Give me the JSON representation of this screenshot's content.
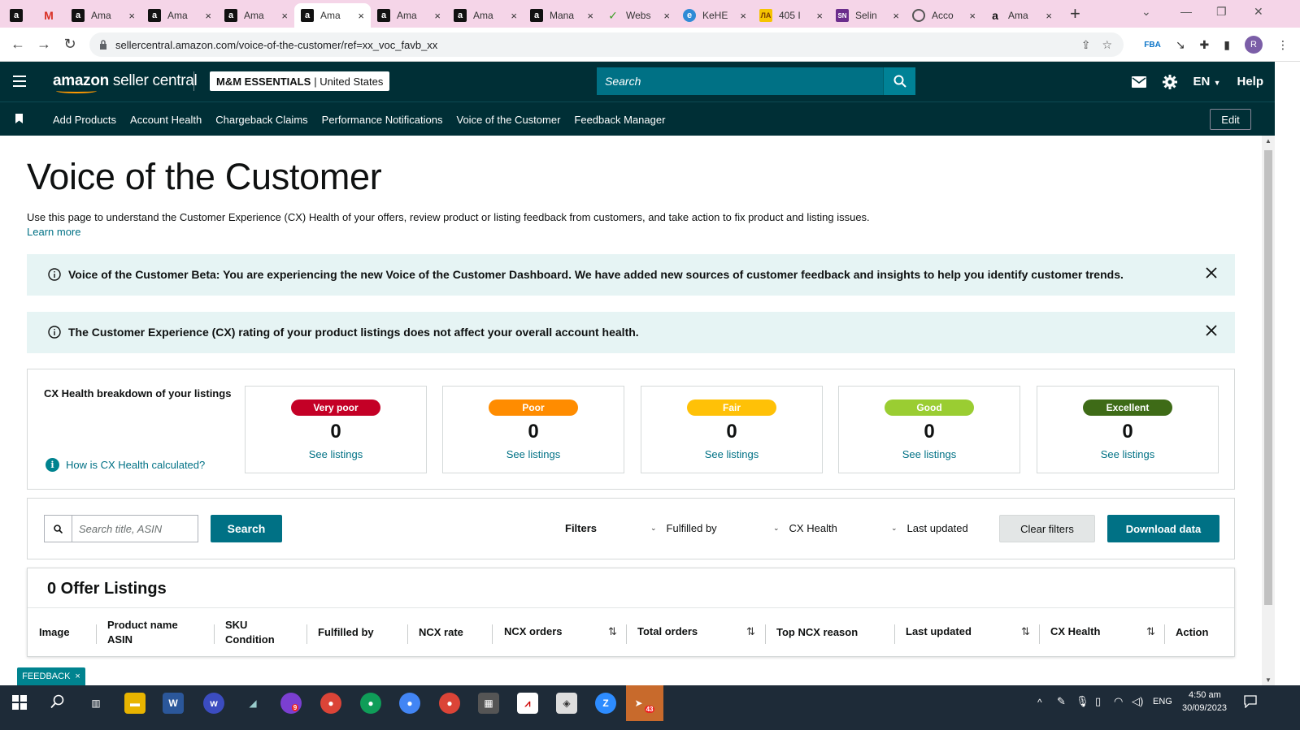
{
  "browser": {
    "tabs": [
      {
        "label": "",
        "icon": "amazon-a"
      },
      {
        "label": "",
        "icon": "gmail-m"
      },
      {
        "label": "Ama",
        "icon": "amazon-a"
      },
      {
        "label": "Ama",
        "icon": "amazon-a"
      },
      {
        "label": "Ama",
        "icon": "amazon-a"
      },
      {
        "label": "Ama",
        "icon": "amazon-a",
        "active": true
      },
      {
        "label": "Ama",
        "icon": "amazon-a"
      },
      {
        "label": "Ama",
        "icon": "amazon-a"
      },
      {
        "label": "Mana",
        "icon": "amazon-a"
      },
      {
        "label": "Webs",
        "icon": "web-leaf"
      },
      {
        "label": "KeHE",
        "icon": "kehe"
      },
      {
        "label": "405 I",
        "icon": "405"
      },
      {
        "label": "Selin",
        "icon": "sn"
      },
      {
        "label": "Acco",
        "icon": "globe"
      },
      {
        "label": "Ama",
        "icon": "amazon-small-a"
      }
    ],
    "tab_close_glyph": "×",
    "new_tab_glyph": "+",
    "url": "sellercentral.amazon.com/voice-of-the-customer/ref=xx_voc_favb_xx",
    "profile_initial": "R"
  },
  "header": {
    "logo_part1": "amazon",
    "logo_part2": " seller central",
    "store_name": "M&M ESSENTIALS",
    "store_region": "| United States",
    "search_placeholder": "Search",
    "language": "EN",
    "help": "Help"
  },
  "nav": {
    "links": [
      "Add Products",
      "Account Health",
      "Chargeback Claims",
      "Performance Notifications",
      "Voice of the Customer",
      "Feedback Manager"
    ],
    "edit": "Edit"
  },
  "page": {
    "title": "Voice of the Customer",
    "intro": "Use this page to understand the Customer Experience (CX) Health of your offers, review product or listing feedback from customers, and take action to fix product and listing issues.",
    "learn_more": "Learn more",
    "banner1": "Voice of the Customer Beta: You are experiencing the new Voice of the Customer Dashboard. We have added new sources of customer feedback and insights to help you identify customer trends.",
    "banner2": "The Customer Experience (CX) rating of your product listings does not affect your overall account health."
  },
  "cx": {
    "title": "CX Health breakdown of your listings",
    "how": "How is CX Health calculated?",
    "categories": [
      {
        "label": "Very poor",
        "count": "0",
        "link": "See listings",
        "color": "#c40026"
      },
      {
        "label": "Poor",
        "count": "0",
        "link": "See listings",
        "color": "#ff8c00"
      },
      {
        "label": "Fair",
        "count": "0",
        "link": "See listings",
        "color": "#ffc107"
      },
      {
        "label": "Good",
        "count": "0",
        "link": "See listings",
        "color": "#9acd32"
      },
      {
        "label": "Excellent",
        "count": "0",
        "link": "See listings",
        "color": "#3e6b17"
      }
    ]
  },
  "filters": {
    "search_placeholder": "Search title, ASIN",
    "search_button": "Search",
    "label": "Filters",
    "fulfilled_by": "Fulfilled by",
    "cx_health": "CX Health",
    "last_updated": "Last updated",
    "clear": "Clear filters",
    "download": "Download data"
  },
  "listings": {
    "title": "0 Offer Listings",
    "columns": {
      "image": "Image",
      "product_name": "Product name",
      "asin": "ASIN",
      "sku": "SKU",
      "condition": "Condition",
      "fulfilled_by": "Fulfilled by",
      "ncx_rate": "NCX rate",
      "ncx_orders": "NCX orders",
      "total_orders": "Total orders",
      "top_ncx_reason": "Top NCX reason",
      "last_updated": "Last updated",
      "cx_health": "CX Health",
      "action": "Action"
    },
    "sort_glyph": "⇅"
  },
  "feedback": {
    "label": "FEEDBACK",
    "close": "×"
  },
  "taskbar": {
    "language": "ENG",
    "time": "4:50 am",
    "date": "30/09/2023",
    "badge_9": "9",
    "badge_43": "43"
  },
  "colors": {
    "header_bg": "#002f36",
    "teal": "#007185",
    "banner_bg": "#e6f4f4"
  }
}
